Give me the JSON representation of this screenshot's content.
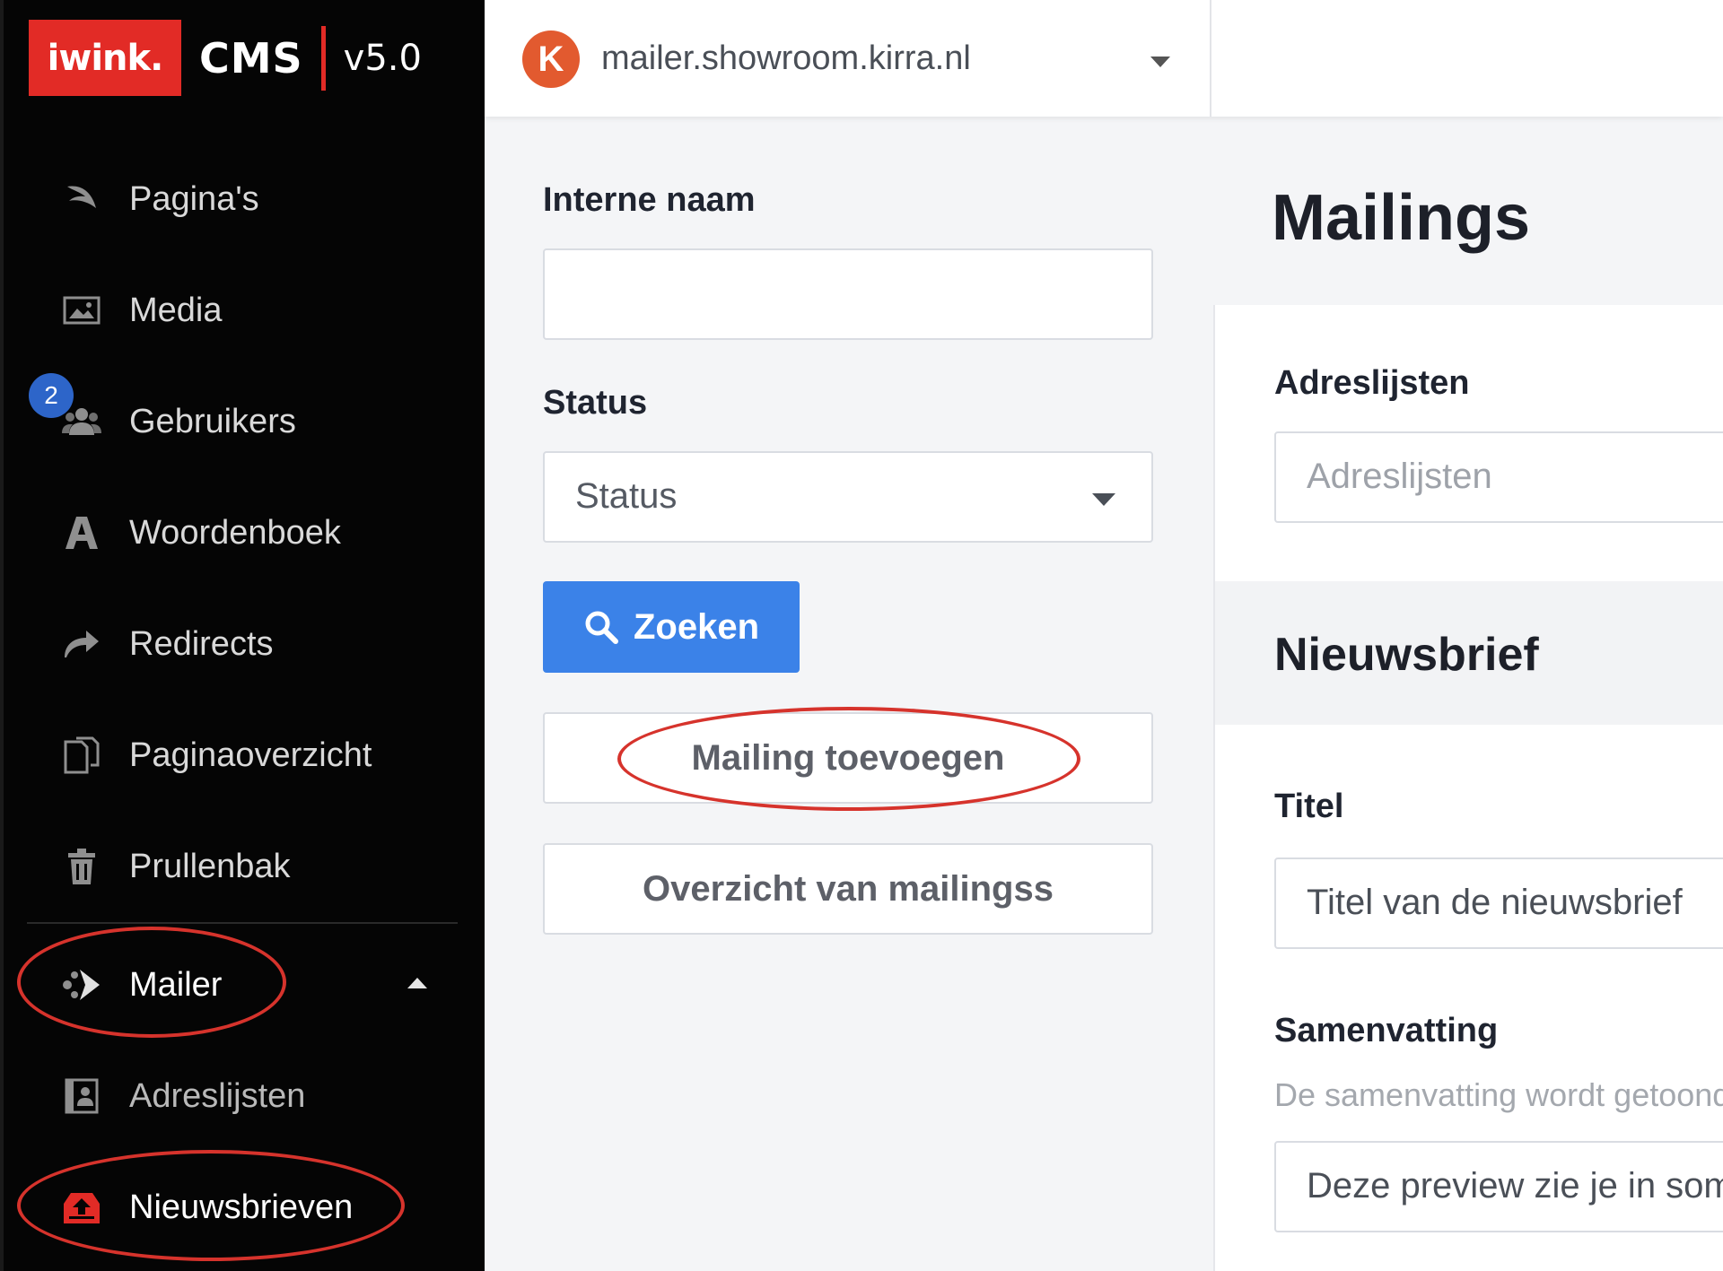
{
  "brand": {
    "logo": "iwink.",
    "product": "CMS",
    "version": "v5.0"
  },
  "sidebar": {
    "items": [
      {
        "label": "Pagina's",
        "icon": "leaf-icon"
      },
      {
        "label": "Media",
        "icon": "image-icon"
      },
      {
        "label": "Gebruikers",
        "icon": "users-icon",
        "badge": "2"
      },
      {
        "label": "Woordenboek",
        "icon": "letter-a-icon"
      },
      {
        "label": "Redirects",
        "icon": "redirect-arrow-icon"
      },
      {
        "label": "Paginaoverzicht",
        "icon": "pages-icon"
      },
      {
        "label": "Prullenbak",
        "icon": "trash-icon"
      },
      {
        "label": "Mailer",
        "icon": "mailer-icon",
        "expanded": true
      },
      {
        "label": "Adreslijsten",
        "icon": "address-book-icon"
      },
      {
        "label": "Nieuwsbrieven",
        "icon": "newsletter-icon",
        "active": true
      }
    ]
  },
  "topbar": {
    "site": "mailer.showroom.kirra.nl",
    "avatar_letter": "K"
  },
  "filters": {
    "internal_name_label": "Interne naam",
    "internal_name_value": "",
    "status_label": "Status",
    "status_value": "Status",
    "search_label": "Zoeken",
    "add_mailing_label": "Mailing toevoegen",
    "overview_label": "Overzicht van mailingss"
  },
  "form": {
    "page_title": "Mailings",
    "address_lists_label": "Adreslijsten",
    "address_lists_placeholder": "Adreslijsten",
    "section_title": "Nieuwsbrief",
    "title_label": "Titel",
    "title_placeholder": "Titel van de nieuwsbrief",
    "summary_label": "Samenvatting",
    "summary_hint": "De samenvatting wordt getoond",
    "summary_value": "Deze preview zie je in sommige mailprogramma's"
  },
  "colors": {
    "accent_red": "#e22b26",
    "primary_blue": "#3b82e8",
    "sidebar_bg": "#050505",
    "highlight_ring": "#d6332c"
  }
}
